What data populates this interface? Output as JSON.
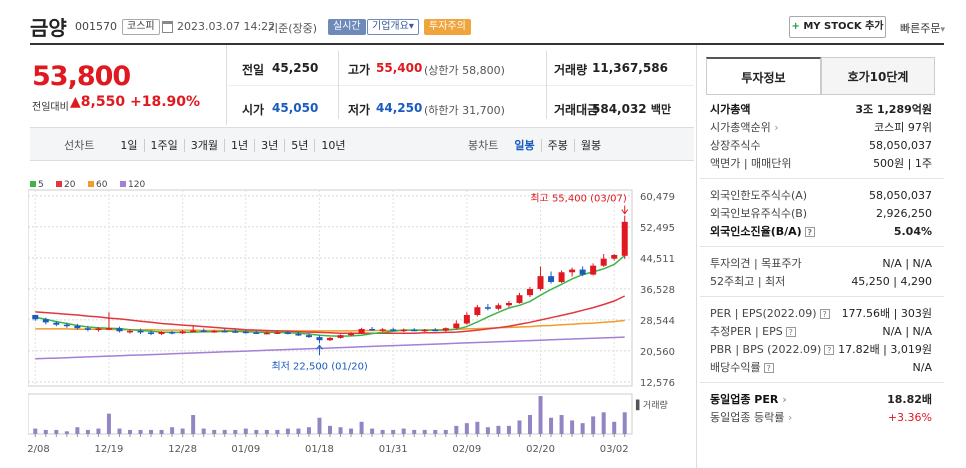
{
  "header": {
    "name": "금양",
    "code": "001570",
    "market": "코스피",
    "datetime": "2023.03.07 14:22",
    "basis": "기준(장중)",
    "tag_realtime": "실시간",
    "tag_overview": "기업개요",
    "tag_overview_arrow": "▾",
    "tag_warning": "투자주의",
    "mystock_label": "MY STOCK 추가",
    "quick_order": "빠른주문"
  },
  "price": {
    "current": "53,800",
    "change_label": "전일대비",
    "change_arrow": "▲",
    "change": "8,550",
    "change_pct": "+18.90%"
  },
  "quote": {
    "prev_label": "전일",
    "prev": "45,250",
    "high_label": "고가",
    "high": "55,400",
    "upper_limit": "(상한가 58,800)",
    "volume_label": "거래량",
    "volume": "11,367,586",
    "open_label": "시가",
    "open": "45,050",
    "low_label": "저가",
    "low": "44,250",
    "lower_limit": "(하한가 31,700)",
    "amount_label": "거래대금",
    "amount": "584,032",
    "amount_unit": "백만"
  },
  "periods": [
    "선차트",
    "1일",
    "1주일",
    "3개월",
    "1년",
    "3년",
    "5년",
    "10년"
  ],
  "candle_periods": [
    "봉차트",
    "일봉",
    "주봉",
    "월봉"
  ],
  "legend": [
    {
      "name": "5",
      "color": "#3db54a"
    },
    {
      "name": "20",
      "color": "#e0383e"
    },
    {
      "name": "60",
      "color": "#f39a2b"
    },
    {
      "name": "120",
      "color": "#a47fd6"
    }
  ],
  "tabs": {
    "invest_info": "투자정보",
    "hoga": "호가10단계"
  },
  "invest": [
    {
      "label": "시가총액",
      "value": "3조 1,289억원",
      "bold": true
    },
    {
      "label": "시가총액순위",
      "value": "코스피 97위",
      "arrow": true
    },
    {
      "label": "상장주식수",
      "value": "58,050,037"
    },
    {
      "label": "액면가 | 매매단위",
      "value": "500원 | 1주"
    },
    {
      "label": "외국인한도주식수(A)",
      "value": "58,050,037"
    },
    {
      "label": "외국인보유주식수(B)",
      "value": "2,926,250"
    },
    {
      "label": "외국인소진율(B/A)",
      "value": "5.04%",
      "bold": true,
      "q": true
    },
    {
      "label": "투자의견 | 목표주가",
      "value": "N/A | N/A"
    },
    {
      "label": "52주최고 | 최저",
      "value": "45,250 | 4,290"
    },
    {
      "label": "PER | EPS(2022.09)",
      "value": "177.56배 | 303원",
      "q": true
    },
    {
      "label": "추정PER | EPS",
      "value": "N/A | N/A",
      "q": true
    },
    {
      "label": "PBR | BPS (2022.09)",
      "value": "17.82배 | 3,019원",
      "q": true
    },
    {
      "label": "배당수익률",
      "value": "N/A",
      "q": true
    },
    {
      "label": "동일업종 PER",
      "value": "18.82배",
      "bold": true,
      "arrow": true
    },
    {
      "label": "동일업종 등락률",
      "value": "+3.36%",
      "arrow": true,
      "red": true
    }
  ],
  "chart_data": {
    "type": "candlestick",
    "x_ticks": [
      "12/08",
      "12/19",
      "12/28",
      "01/09",
      "01/18",
      "01/31",
      "02/09",
      "02/20",
      "03/02"
    ],
    "y_ticks": [
      60479,
      52495,
      44511,
      36528,
      28544,
      20560,
      12576
    ],
    "ylim": [
      11500,
      62000
    ],
    "max_label": "최고 55,400 (03/07)",
    "min_label": "최저 22,500 (01/20)",
    "volume_label": "거래량",
    "candles": [
      [
        29800,
        29800,
        28300,
        28700
      ],
      [
        28700,
        29100,
        27400,
        27900
      ],
      [
        27800,
        28200,
        26900,
        27300
      ],
      [
        27300,
        27800,
        26500,
        27000
      ],
      [
        27000,
        27500,
        26100,
        26400
      ],
      [
        26400,
        27000,
        25600,
        26000
      ],
      [
        26000,
        26700,
        25500,
        26300
      ],
      [
        26300,
        30500,
        25900,
        26400
      ],
      [
        26400,
        26800,
        25300,
        25600
      ],
      [
        25600,
        26200,
        25000,
        25700
      ],
      [
        25700,
        26300,
        24900,
        25300
      ],
      [
        25300,
        25800,
        24600,
        24900
      ],
      [
        24900,
        25600,
        24600,
        25400
      ],
      [
        25400,
        25700,
        24800,
        25100
      ],
      [
        25100,
        25900,
        24900,
        25600
      ],
      [
        25600,
        27100,
        25300,
        25800
      ],
      [
        25800,
        26300,
        25300,
        25500
      ],
      [
        25500,
        26000,
        25200,
        25700
      ],
      [
        25700,
        26200,
        25300,
        25600
      ],
      [
        25600,
        26100,
        25200,
        25500
      ],
      [
        25500,
        26000,
        25000,
        25300
      ],
      [
        25300,
        25800,
        24900,
        25100
      ],
      [
        25100,
        25600,
        24800,
        25200
      ],
      [
        25200,
        25700,
        24900,
        25300
      ],
      [
        25300,
        25800,
        24800,
        24900
      ],
      [
        24900,
        25400,
        24400,
        24600
      ],
      [
        24600,
        25100,
        23900,
        24100
      ],
      [
        24100,
        24500,
        22500,
        23300
      ],
      [
        23300,
        24100,
        23100,
        23900
      ],
      [
        23900,
        24800,
        23700,
        24600
      ],
      [
        24600,
        25400,
        24400,
        25100
      ],
      [
        25100,
        26500,
        24900,
        26200
      ],
      [
        26200,
        26700,
        25700,
        25900
      ],
      [
        25900,
        26400,
        25500,
        26100
      ],
      [
        26100,
        26500,
        25600,
        25800
      ],
      [
        25800,
        26300,
        25400,
        26000
      ],
      [
        26000,
        26400,
        25600,
        25700
      ],
      [
        25700,
        26200,
        25400,
        26000
      ],
      [
        26000,
        26400,
        25600,
        25800
      ],
      [
        25800,
        26600,
        25500,
        26400
      ],
      [
        26400,
        28400,
        26100,
        27600
      ],
      [
        27600,
        30500,
        27300,
        29800
      ],
      [
        29800,
        32400,
        29400,
        31800
      ],
      [
        31800,
        32600,
        31000,
        31400
      ],
      [
        31400,
        32800,
        31000,
        32300
      ],
      [
        32300,
        33400,
        31800,
        32900
      ],
      [
        32900,
        35500,
        32700,
        34900
      ],
      [
        34900,
        37000,
        34400,
        36500
      ],
      [
        36500,
        42300,
        36100,
        39800
      ],
      [
        39800,
        41000,
        37900,
        38300
      ],
      [
        38300,
        41300,
        38000,
        40800
      ],
      [
        40800,
        42000,
        39700,
        41500
      ],
      [
        41500,
        42300,
        39800,
        40200
      ],
      [
        40200,
        43100,
        40000,
        42500
      ],
      [
        42500,
        45500,
        42200,
        44300
      ],
      [
        44300,
        45500,
        43800,
        45250
      ],
      [
        45050,
        55400,
        44250,
        53800
      ]
    ],
    "volumes": [
      4,
      3,
      3,
      2,
      5,
      3,
      4,
      15,
      4,
      3,
      3,
      3,
      3,
      5,
      4,
      14,
      4,
      3,
      3,
      3,
      4,
      3,
      3,
      3,
      4,
      4,
      5,
      12,
      6,
      5,
      4,
      9,
      4,
      3,
      3,
      4,
      3,
      3,
      3,
      3,
      6,
      8,
      9,
      5,
      6,
      6,
      10,
      14,
      28,
      12,
      14,
      10,
      8,
      13,
      16,
      9,
      16
    ],
    "ma5": [
      29200,
      28700,
      28100,
      27600,
      27100,
      26700,
      26500,
      26400,
      26300,
      26000,
      25800,
      25600,
      25400,
      25300,
      25300,
      25400,
      25500,
      25500,
      25600,
      25600,
      25500,
      25400,
      25300,
      25300,
      25200,
      25100,
      24900,
      24600,
      24400,
      24300,
      24400,
      24600,
      25000,
      25300,
      25600,
      25900,
      25900,
      25900,
      25900,
      25900,
      26100,
      26800,
      28000,
      29300,
      30500,
      31600,
      32300,
      33300,
      34900,
      36400,
      37700,
      39100,
      40200,
      40900,
      41700,
      42800,
      45100
    ],
    "ma20": [
      30600,
      30400,
      30200,
      30000,
      29800,
      29500,
      29300,
      29000,
      28800,
      28500,
      28200,
      27900,
      27600,
      27400,
      27200,
      27000,
      26800,
      26600,
      26400,
      26200,
      26000,
      25900,
      25800,
      25700,
      25600,
      25500,
      25400,
      25300,
      25200,
      25100,
      25100,
      25100,
      25100,
      25100,
      25100,
      25100,
      25100,
      25200,
      25200,
      25300,
      25400,
      25600,
      25900,
      26200,
      26500,
      26900,
      27400,
      27900,
      28500,
      29100,
      29700,
      30300,
      31000,
      31700,
      32500,
      33400,
      34700
    ],
    "ma60": [
      26200,
      26200,
      26200,
      26200,
      26100,
      26100,
      26100,
      26100,
      26000,
      26000,
      26000,
      26000,
      25900,
      25900,
      25900,
      25900,
      25800,
      25800,
      25800,
      25800,
      25800,
      25800,
      25700,
      25700,
      25700,
      25700,
      25700,
      25700,
      25700,
      25700,
      25700,
      25800,
      25800,
      25800,
      25800,
      25900,
      25900,
      25900,
      26000,
      26000,
      26100,
      26200,
      26300,
      26400,
      26500,
      26600,
      26700,
      26800,
      27000,
      27100,
      27300,
      27400,
      27600,
      27700,
      27900,
      28100,
      28400
    ],
    "ma120": [
      18500,
      18600,
      18700,
      18800,
      18900,
      19000,
      19100,
      19200,
      19300,
      19400,
      19500,
      19600,
      19700,
      19800,
      19900,
      20000,
      20100,
      20200,
      20300,
      20400,
      20500,
      20600,
      20700,
      20800,
      20900,
      21000,
      21100,
      21200,
      21300,
      21400,
      21500,
      21600,
      21700,
      21800,
      21900,
      22000,
      22100,
      22200,
      22300,
      22400,
      22500,
      22600,
      22700,
      22800,
      22900,
      23000,
      23100,
      23200,
      23300,
      23400,
      23500,
      23600,
      23700,
      23800,
      23900,
      24000,
      24100
    ]
  }
}
